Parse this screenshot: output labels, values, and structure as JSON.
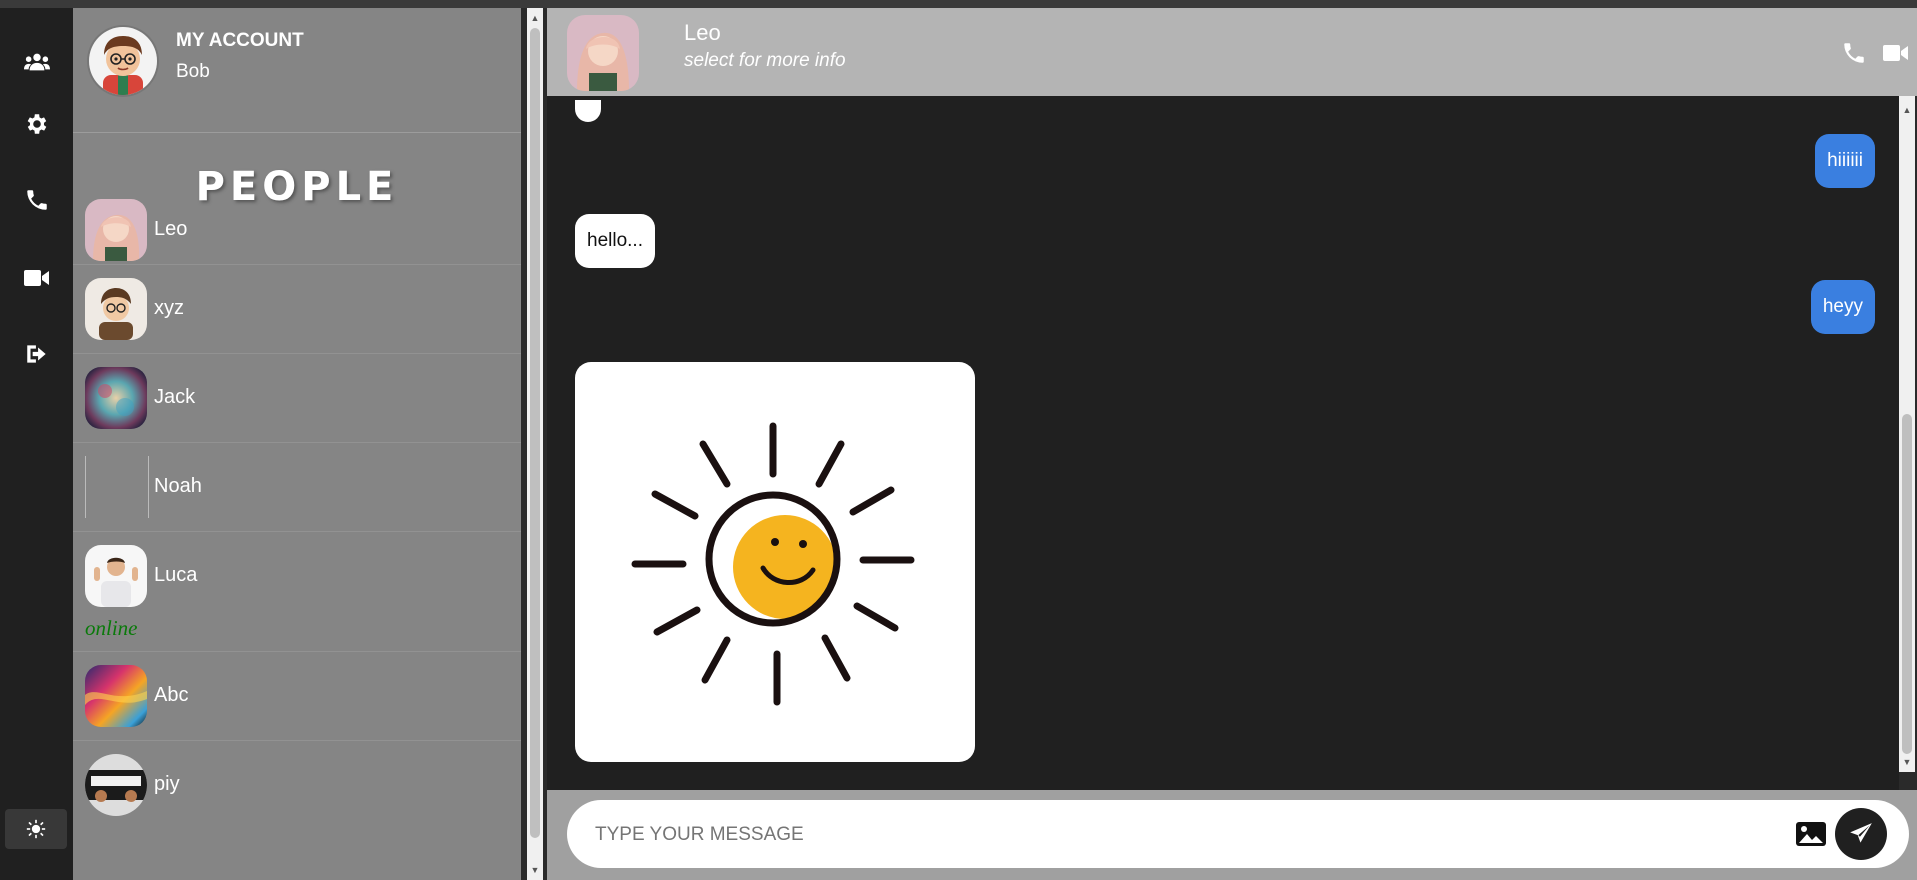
{
  "account": {
    "title": "MY ACCOUNT",
    "name": "Bob"
  },
  "people_title": "PEOPLE",
  "rail": {
    "icons": [
      "users-icon",
      "gear-icon",
      "phone-icon",
      "video-icon",
      "logout-icon",
      "theme-toggle-icon"
    ]
  },
  "contacts": [
    {
      "name": "Leo",
      "status": ""
    },
    {
      "name": "xyz",
      "status": ""
    },
    {
      "name": "Jack",
      "status": ""
    },
    {
      "name": "Noah",
      "status": ""
    },
    {
      "name": "Luca",
      "status": "online"
    },
    {
      "name": "Abc",
      "status": ""
    },
    {
      "name": "piy",
      "status": ""
    }
  ],
  "chat": {
    "contact_name": "Leo",
    "subtitle": "select for more info",
    "messages": [
      {
        "direction": "out",
        "text": "hiiiiii"
      },
      {
        "direction": "in",
        "text": "hello..."
      },
      {
        "direction": "out",
        "text": "heyy"
      },
      {
        "direction": "in",
        "type": "image",
        "image": "smiling-sun-sticker"
      }
    ]
  },
  "composer": {
    "placeholder": "TYPE YOUR MESSAGE"
  },
  "colors": {
    "rail_bg": "#202020",
    "panel_bg": "#858585",
    "header_bg": "#b4b4b4",
    "chat_bg": "#202020",
    "outgoing_bubble": "#3a7fe0",
    "incoming_bubble": "#ffffff",
    "online_status": "#0a7a0a"
  }
}
